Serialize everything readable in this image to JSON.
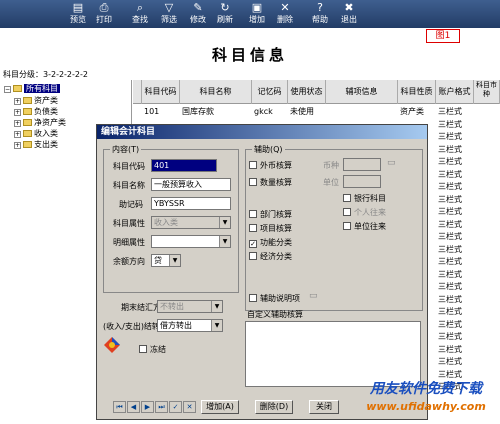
{
  "toolbar": {
    "buttons": [
      {
        "label": "预览",
        "icon": "preview-icon"
      },
      {
        "label": "打印",
        "icon": "print-icon"
      },
      {
        "label": "查找",
        "icon": "find-icon"
      },
      {
        "label": "筛选",
        "icon": "filter-icon"
      },
      {
        "label": "修改",
        "icon": "edit-icon"
      },
      {
        "label": "刷新",
        "icon": "refresh-icon"
      },
      {
        "label": "增加",
        "icon": "add-icon"
      },
      {
        "label": "删除",
        "icon": "delete-icon"
      },
      {
        "label": "帮助",
        "icon": "help-icon"
      },
      {
        "label": "退出",
        "icon": "exit-icon"
      }
    ]
  },
  "figure_label": "图1",
  "page_title": "科目信息",
  "levels_text": "科目分级：3-2-2-2-2-2",
  "tree": {
    "root": "所有科目",
    "items": [
      "资产类",
      "负债类",
      "净资产类",
      "收入类",
      "支出类"
    ]
  },
  "grid": {
    "columns": [
      "科目代码",
      "科目名称",
      "记忆码",
      "使用状态",
      "辅项信息",
      "科目性质",
      "账户格式",
      "科目市种"
    ],
    "rows": [
      {
        "code": "101",
        "name": "国库存款",
        "memo": "gkck",
        "status": "未使用",
        "aux": "",
        "nature": "资产类",
        "format": "三栏式"
      },
      {
        "code": "",
        "name": "",
        "memo": "",
        "status": "",
        "aux": "",
        "nature": "",
        "format": "三栏式"
      },
      {
        "code": "",
        "name": "",
        "memo": "",
        "status": "",
        "aux": "",
        "nature": "",
        "format": "三栏式"
      },
      {
        "code": "",
        "name": "",
        "memo": "",
        "status": "",
        "aux": "",
        "nature": "",
        "format": "三栏式"
      },
      {
        "code": "",
        "name": "",
        "memo": "",
        "status": "",
        "aux": "",
        "nature": "",
        "format": "三栏式"
      },
      {
        "code": "",
        "name": "",
        "memo": "",
        "status": "",
        "aux": "",
        "nature": "",
        "format": "三栏式"
      },
      {
        "code": "",
        "name": "",
        "memo": "",
        "status": "",
        "aux": "",
        "nature": "",
        "format": "三栏式"
      },
      {
        "code": "",
        "name": "",
        "memo": "",
        "status": "",
        "aux": "",
        "nature": "",
        "format": "三栏式"
      },
      {
        "code": "",
        "name": "",
        "memo": "",
        "status": "",
        "aux": "",
        "nature": "",
        "format": "三栏式"
      },
      {
        "code": "",
        "name": "",
        "memo": "",
        "status": "",
        "aux": "",
        "nature": "",
        "format": "三栏式"
      },
      {
        "code": "",
        "name": "",
        "memo": "",
        "status": "",
        "aux": "",
        "nature": "",
        "format": "三栏式"
      },
      {
        "code": "",
        "name": "",
        "memo": "",
        "status": "",
        "aux": "",
        "nature": "",
        "format": "三栏式"
      },
      {
        "code": "",
        "name": "",
        "memo": "",
        "status": "",
        "aux": "",
        "nature": "",
        "format": "三栏式"
      },
      {
        "code": "",
        "name": "",
        "memo": "",
        "status": "",
        "aux": "",
        "nature": "",
        "format": "三栏式"
      },
      {
        "code": "",
        "name": "",
        "memo": "",
        "status": "",
        "aux": "",
        "nature": "",
        "format": "三栏式"
      },
      {
        "code": "",
        "name": "",
        "memo": "",
        "status": "",
        "aux": "",
        "nature": "",
        "format": "三栏式"
      },
      {
        "code": "",
        "name": "",
        "memo": "",
        "status": "",
        "aux": "",
        "nature": "",
        "format": "三栏式"
      },
      {
        "code": "",
        "name": "",
        "memo": "",
        "status": "",
        "aux": "",
        "nature": "",
        "format": "三栏式"
      },
      {
        "code": "",
        "name": "",
        "memo": "",
        "status": "",
        "aux": "",
        "nature": "",
        "format": "三栏式"
      },
      {
        "code": "",
        "name": "",
        "memo": "",
        "status": "",
        "aux": "",
        "nature": "",
        "format": "三栏式"
      },
      {
        "code": "",
        "name": "",
        "memo": "",
        "status": "",
        "aux": "",
        "nature": "",
        "format": "三栏式"
      },
      {
        "code": "",
        "name": "",
        "memo": "",
        "status": "",
        "aux": "",
        "nature": "",
        "format": "三栏式"
      },
      {
        "code": "",
        "name": "",
        "memo": "",
        "status": "",
        "aux": "",
        "nature": "",
        "format": "三栏式"
      }
    ]
  },
  "dialog": {
    "title": "编辑会计科目",
    "content_group": "内容(T)",
    "fields": {
      "code_label": "科目代码",
      "code_value": "401",
      "name_label": "科目名称",
      "name_value": "一般预算收入",
      "memo_label": "助记码",
      "memo_value": "YBYSSR",
      "property_label": "科目属性",
      "property_value": "收入类",
      "detail_label": "明细属性",
      "detail_value": "",
      "balance_label": "余额方向",
      "balance_value": "贷",
      "period_label": "期末结汇方向",
      "period_value": "不转出",
      "transfer_label": "(收入/支出)结转方向",
      "transfer_value": "借方转出",
      "freeze_label": "冻结"
    },
    "aux_group": "辅助(Q)",
    "aux": {
      "foreign": "外币核算",
      "currency_label": "币种",
      "quantity": "数量核算",
      "unit_label": "单位",
      "bank": "银行科目",
      "personal": "个人往来",
      "unit_contact": "单位往来",
      "dept": "部门核算",
      "project": "项目核算",
      "function": "功能分类",
      "economic": "经济分类",
      "aux_note": "辅助说明项"
    },
    "custom_group": "自定义辅助核算",
    "buttons": {
      "add": "增加(A)",
      "delete": "删除(D)",
      "close": "关闭"
    }
  },
  "watermark": {
    "text": "用友软件免费下载",
    "url": "www.ufidawhy.com"
  }
}
